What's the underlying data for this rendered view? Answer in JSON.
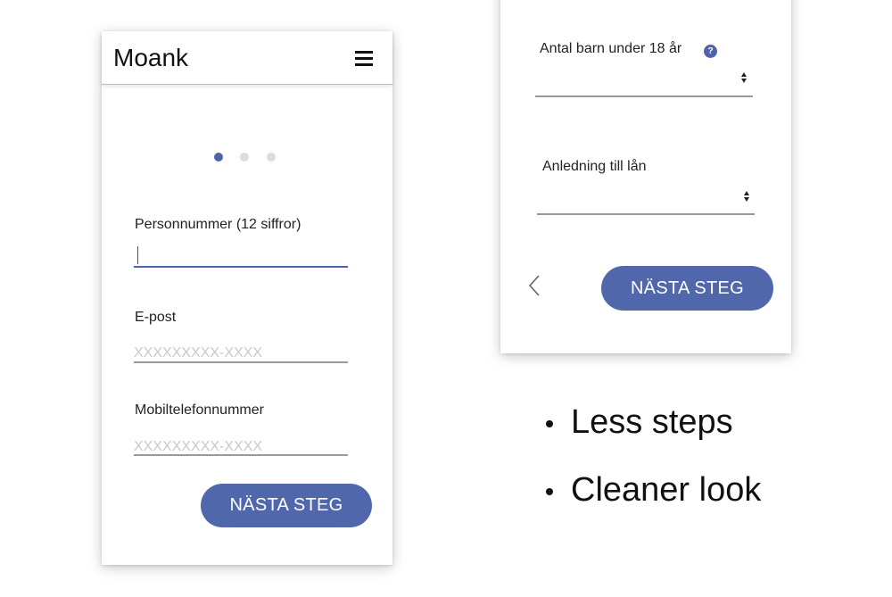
{
  "phone_left": {
    "app_title": "Moank",
    "menu_icon": "hamburger-menu-icon",
    "steps": {
      "total": 3,
      "current": 1
    },
    "fields": {
      "personnummer": {
        "label": "Personnummer (12 siffror)",
        "value": ""
      },
      "email": {
        "label": "E-post",
        "placeholder": "XXXXXXXXX-XXXX"
      },
      "mobile": {
        "label": "Mobiltelefonnummer",
        "placeholder": "XXXXXXXXX-XXXX"
      }
    },
    "next_button": "NÄSTA STEG"
  },
  "phone_right": {
    "children_select": {
      "label": "Antal barn under 18 år",
      "help": "?"
    },
    "reason_select": {
      "label": "Anledning till lån"
    },
    "back_icon": "chevron-left-icon",
    "next_button": "NÄSTA STEG"
  },
  "bullets": [
    "Less steps",
    "Cleaner look"
  ],
  "colors": {
    "accent": "#4e66a9",
    "button": "#5167ab",
    "dot_inactive": "#dcdcdc",
    "underline": "#999999"
  }
}
